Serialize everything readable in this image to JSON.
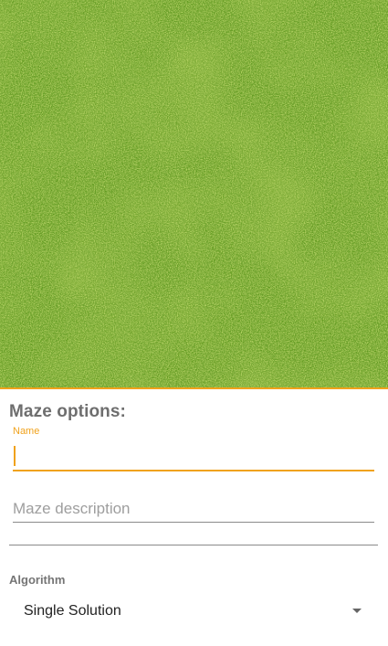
{
  "maze_form": {
    "title": "Maze options:",
    "name_label": "Name",
    "name_value": "",
    "description_placeholder": "Maze description",
    "description_value": "",
    "algorithm_label": "Algorithm",
    "algorithm_selected": "Single Solution"
  },
  "colors": {
    "accent": "#f0a21c",
    "grass_base": "#5f9a1c",
    "text_muted": "#6e6e6e"
  },
  "icons": {
    "dropdown": "triangle-down-icon"
  }
}
